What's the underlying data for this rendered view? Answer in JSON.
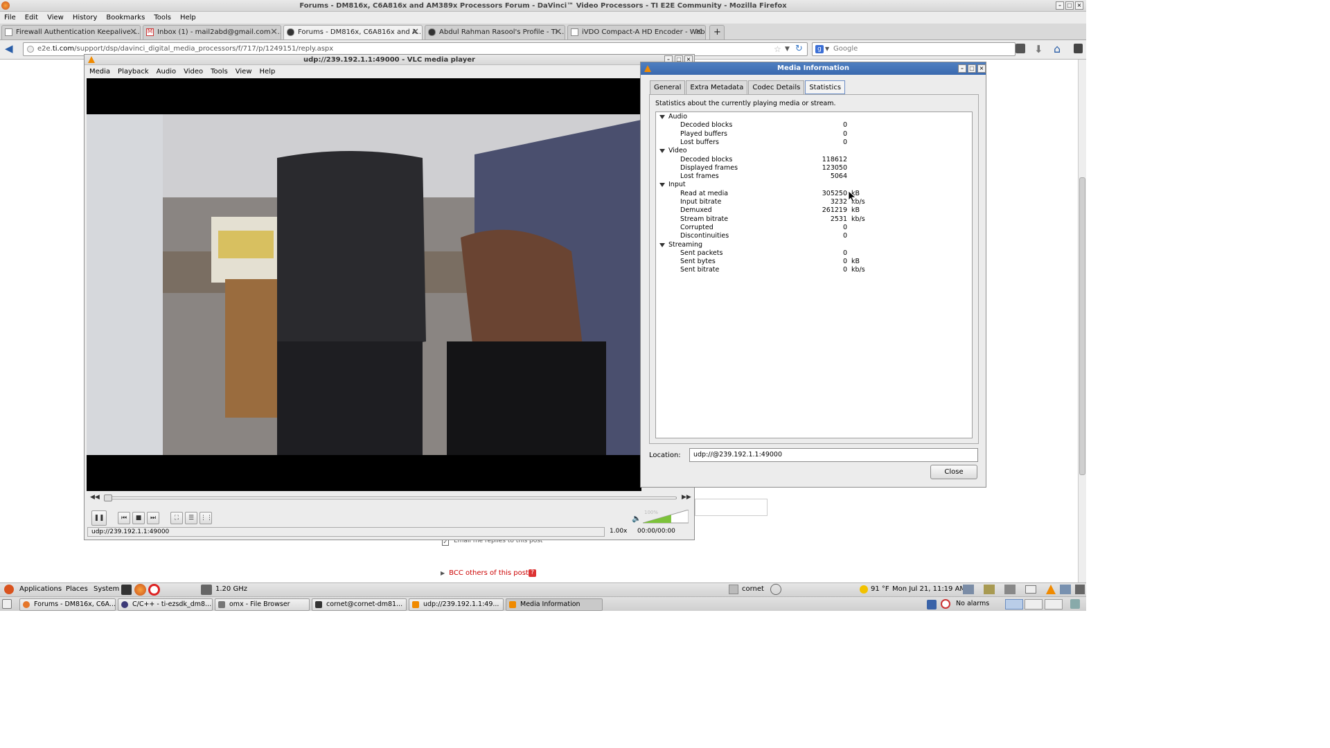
{
  "firefox": {
    "title": "Forums - DM816x, C6A816x and AM389x Processors Forum - DaVinci™ Video Processors - TI E2E Community - Mozilla Firefox",
    "menu": [
      "File",
      "Edit",
      "View",
      "History",
      "Bookmarks",
      "Tools",
      "Help"
    ],
    "tabs": [
      {
        "label": "Firewall Authentication Keepalive ..."
      },
      {
        "label": "Inbox (1) - mail2abd@gmail.com - ..."
      },
      {
        "label": "Forums - DM816x, C6A816x and A..."
      },
      {
        "label": "Abdul Rahman Rasool's Profile - TI ..."
      },
      {
        "label": "iVDO Compact-A HD Encoder - Web..."
      }
    ],
    "url_domain": "e2e.ti.com",
    "url_prefix": "e2e.",
    "url_host": "ti.com",
    "url_path": "/support/dsp/davinci_digital_media_processors/f/717/p/1249151/reply.aspx",
    "search_placeholder": "Google"
  },
  "vlc": {
    "title": "udp://239.192.1.1:49000 - VLC media player",
    "menu": [
      "Media",
      "Playback",
      "Audio",
      "Video",
      "Tools",
      "View",
      "Help"
    ],
    "status_url": "udp://239.192.1.1:49000",
    "speed": "1.00x",
    "time": "00:00/00:00",
    "volume_label": "100%",
    "volume_level": 1.0
  },
  "media_info": {
    "title": "Media Information",
    "tabs": [
      "General",
      "Extra Metadata",
      "Codec Details",
      "Statistics"
    ],
    "active_tab": "Statistics",
    "description": "Statistics about the currently playing media or stream.",
    "sections": [
      {
        "name": "Audio",
        "rows": [
          {
            "label": "Decoded blocks",
            "value": "0",
            "unit": ""
          },
          {
            "label": "Played buffers",
            "value": "0",
            "unit": ""
          },
          {
            "label": "Lost buffers",
            "value": "0",
            "unit": ""
          }
        ]
      },
      {
        "name": "Video",
        "rows": [
          {
            "label": "Decoded blocks",
            "value": "118612",
            "unit": ""
          },
          {
            "label": "Displayed frames",
            "value": "123050",
            "unit": ""
          },
          {
            "label": "Lost frames",
            "value": "5064",
            "unit": ""
          }
        ]
      },
      {
        "name": "Input",
        "rows": [
          {
            "label": "Read at media",
            "value": "305250",
            "unit": "kB"
          },
          {
            "label": "Input bitrate",
            "value": "3232",
            "unit": "kb/s"
          },
          {
            "label": "Demuxed",
            "value": "261219",
            "unit": "kB"
          },
          {
            "label": "Stream bitrate",
            "value": "2531",
            "unit": "kb/s"
          },
          {
            "label": "Corrupted",
            "value": "0",
            "unit": ""
          },
          {
            "label": "Discontinuities",
            "value": "0",
            "unit": ""
          }
        ]
      },
      {
        "name": "Streaming",
        "rows": [
          {
            "label": "Sent packets",
            "value": "0",
            "unit": ""
          },
          {
            "label": "Sent bytes",
            "value": "0",
            "unit": "kB"
          },
          {
            "label": "Sent bitrate",
            "value": "0",
            "unit": "kb/s"
          }
        ]
      }
    ],
    "location_label": "Location:",
    "location_value": "udp://@239.192.1.1:49000",
    "close_label": "Close"
  },
  "page": {
    "email_me": "Email me replies to this post",
    "bcc": "BCC others of this post"
  },
  "top_panel": {
    "applications": "Applications",
    "places": "Places",
    "system": "System",
    "cpu": "1.20 GHz",
    "user": "cornet",
    "weather": "91 °F",
    "clock": "Mon Jul 21, 11:19 AM"
  },
  "bottom_panel": {
    "tasks": [
      {
        "label": "Forums - DM816x, C6A..."
      },
      {
        "label": "C/C++ - ti-ezsdk_dm8..."
      },
      {
        "label": "omx - File Browser"
      },
      {
        "label": "cornet@cornet-dm81..."
      },
      {
        "label": "udp://239.192.1.1:49..."
      },
      {
        "label": "Media Information"
      }
    ],
    "alarms": "No alarms"
  },
  "colors": {
    "accent": "#3a69ae",
    "bcc_red": "#cc0000"
  }
}
